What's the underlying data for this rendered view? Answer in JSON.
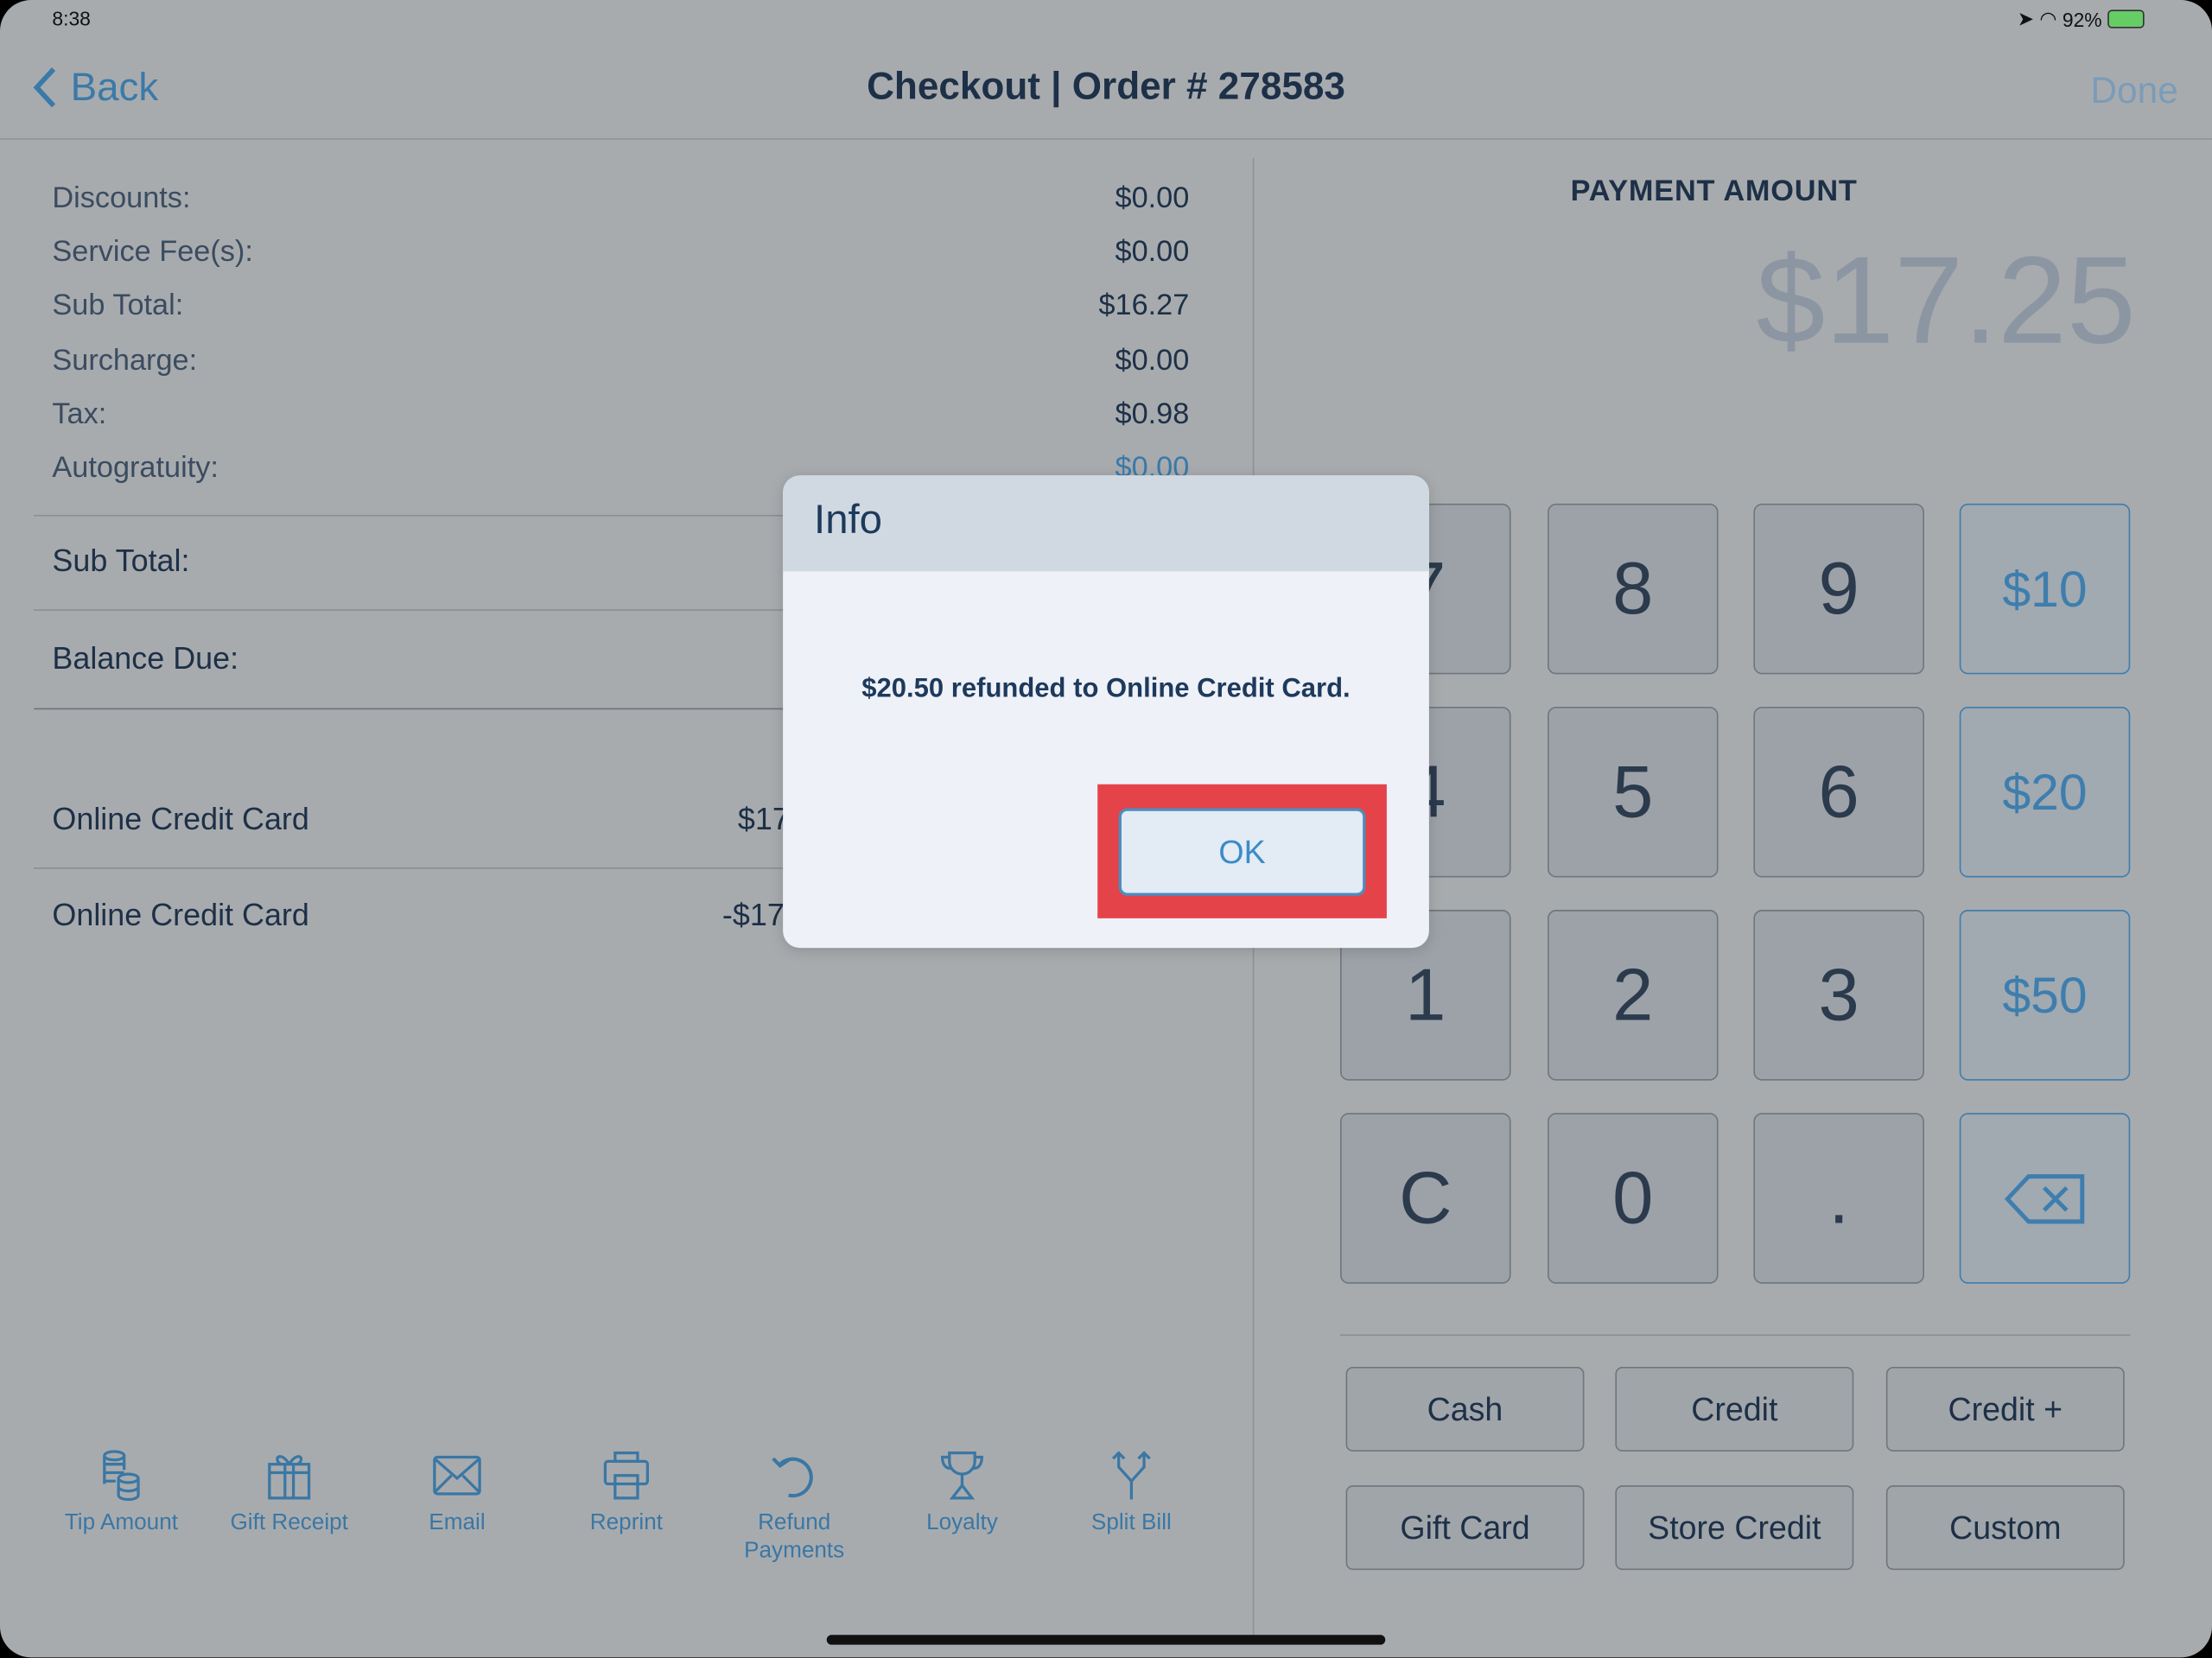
{
  "status_bar": {
    "time": "8:38",
    "battery": "92%"
  },
  "nav": {
    "back_label": "Back",
    "title": "Checkout | Order # 278583",
    "done_label": "Done"
  },
  "summary": {
    "rows": [
      {
        "label": "Discounts:",
        "value": "$0.00"
      },
      {
        "label": "Service Fee(s):",
        "value": "$0.00"
      },
      {
        "label": "Sub Total:",
        "value": "$16.27"
      },
      {
        "label": "Surcharge:",
        "value": "$0.00"
      },
      {
        "label": "Tax:",
        "value": "$0.98"
      },
      {
        "label": "Autogratuity:",
        "value": "$0.00"
      }
    ],
    "subtotal_label": "Sub Total:",
    "balance_label": "Balance Due:",
    "payments": [
      {
        "label": "Online Credit Card",
        "value": "$17"
      },
      {
        "label": "Online Credit Card",
        "value": "-$17"
      }
    ]
  },
  "payment": {
    "heading": "PAYMENT AMOUNT",
    "amount": "$17.25"
  },
  "keypad": {
    "keys": [
      "7",
      "8",
      "9",
      "$10",
      "4",
      "5",
      "6",
      "$20",
      "1",
      "2",
      "3",
      "$50",
      "C",
      "0",
      "."
    ],
    "backspace_icon": "backspace-icon"
  },
  "tender_buttons": [
    "Cash",
    "Credit",
    "Credit +",
    "Gift Card",
    "Store Credit",
    "Custom"
  ],
  "toolbar": [
    {
      "label": "Tip Amount",
      "icon": "coins-icon"
    },
    {
      "label": "Gift Receipt",
      "icon": "gift-icon"
    },
    {
      "label": "Email",
      "icon": "envelope-icon"
    },
    {
      "label": "Reprint",
      "icon": "printer-icon"
    },
    {
      "label": "Refund Payments",
      "icon": "undo-icon"
    },
    {
      "label": "Loyalty",
      "icon": "trophy-icon"
    },
    {
      "label": "Split Bill",
      "icon": "split-icon"
    }
  ],
  "dialog": {
    "title": "Info",
    "message": "$20.50 refunded to Online Credit Card.",
    "ok_label": "OK",
    "highlight_color": "#e5434a"
  },
  "colors": {
    "accent": "#3d7eae",
    "text": "#1d3047",
    "overlay": "#a8abae"
  }
}
